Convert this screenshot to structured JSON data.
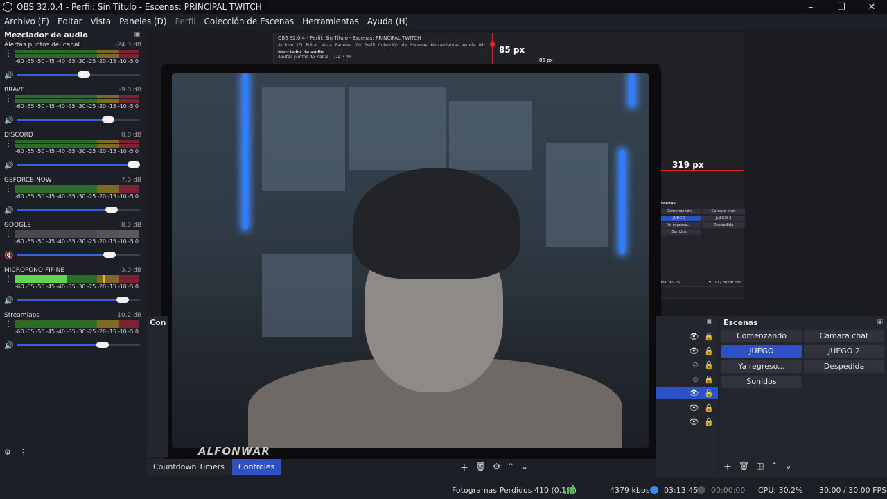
{
  "window": {
    "title": "OBS 32.0.4 - Perfil: Sin Título - Escenas: PRINCIPAL TWITCH"
  },
  "menu": [
    {
      "label": "Archivo (F)",
      "disabled": false
    },
    {
      "label": "Editar",
      "disabled": false
    },
    {
      "label": "Vista",
      "disabled": false
    },
    {
      "label": "Paneles (D)",
      "disabled": false
    },
    {
      "label": "Perfil",
      "disabled": true
    },
    {
      "label": "Colección de Escenas",
      "disabled": false
    },
    {
      "label": "Herramientas",
      "disabled": false
    },
    {
      "label": "Ayuda (H)",
      "disabled": false
    }
  ],
  "mixer": {
    "title": "Mezclador de audio",
    "ticks": "-60 -55 -50 -45 -40 -35 -30 -25 -20 -15 -10 -5 0",
    "channels": [
      {
        "name": "Alertas puntos del canal",
        "db": "-24.3 dB",
        "volume": 0.55,
        "level": 0,
        "muted": false
      },
      {
        "name": "BRAVE",
        "db": "-9.0 dB",
        "volume": 0.77,
        "level": 0,
        "muted": false
      },
      {
        "name": "DISCORD",
        "db": "0.0 dB",
        "volume": 1.0,
        "level": 0,
        "muted": false
      },
      {
        "name": "GEFORCE-NOW",
        "db": "-7.0 dB",
        "volume": 0.8,
        "level": 0,
        "muted": false
      },
      {
        "name": "GOOGLE",
        "db": "-8.0 dB",
        "volume": 0.78,
        "level": 0,
        "muted": true
      },
      {
        "name": "MICROFONO FIFINE",
        "db": "-3.0 dB",
        "volume": 0.9,
        "level": 0.42,
        "muted": false
      },
      {
        "name": "Streamlaps",
        "db": "-10.2 dB",
        "volume": 0.72,
        "level": 0,
        "muted": false
      }
    ]
  },
  "preview": {
    "nested_title": "OBS 32.0.4 - Perfil: Sin Título - Escenas: PRINCIPAL TWITCH",
    "nested_menu": "Archivo (F) Editar Vista Paneles (D) Perfil Colección de Escenas Herramientas Ayuda (H)",
    "nested_mixer_title": "Mezclador de audio",
    "nested_mixer_channel": "Alertas puntos del canal",
    "nested_mixer_db": "-24.3 dB",
    "measure_top": "85 px",
    "measure_top_small": "85 px",
    "measure_right": "319 px",
    "watermark": "ALFONWAR",
    "nested_scenes_title": "Escenas",
    "nested_scenes": [
      "Comenzando",
      "Camara chat",
      "JUEGO",
      "JUEGO 2",
      "Ya regreso...",
      "Despedida",
      "Sonidos"
    ],
    "nested_status": "CPU: 30.2%",
    "nested_fps": "30.00 / 30.00 FPS"
  },
  "sources_dock_label": "Con",
  "scenes": {
    "title": "Escenas",
    "items": [
      {
        "label": "Comenzando",
        "active": false
      },
      {
        "label": "Camara chat",
        "active": false
      },
      {
        "label": "JUEGO",
        "active": true
      },
      {
        "label": "JUEGO 2",
        "active": false
      },
      {
        "label": "Ya regreso...",
        "active": false
      },
      {
        "label": "Despedida",
        "active": false
      },
      {
        "label": "Sonidos",
        "active": false
      }
    ]
  },
  "tabs": [
    {
      "label": "Countdown Timers",
      "active": false
    },
    {
      "label": "Controles",
      "active": true
    }
  ],
  "status": {
    "dropped": "Fotogramas Perdidos 410 (0.1%)",
    "bitrate": "4379 kbps",
    "stream_time": "03:13:45",
    "rec_time": "00:00:00",
    "cpu": "CPU: 30.2%",
    "fps": "30.00 / 30.00 FPS"
  },
  "colors": {
    "accent": "#2d52c8",
    "meter_green": "#5fd64c",
    "live_blue": "#3a8df0",
    "measure_red": "#e0202a"
  }
}
